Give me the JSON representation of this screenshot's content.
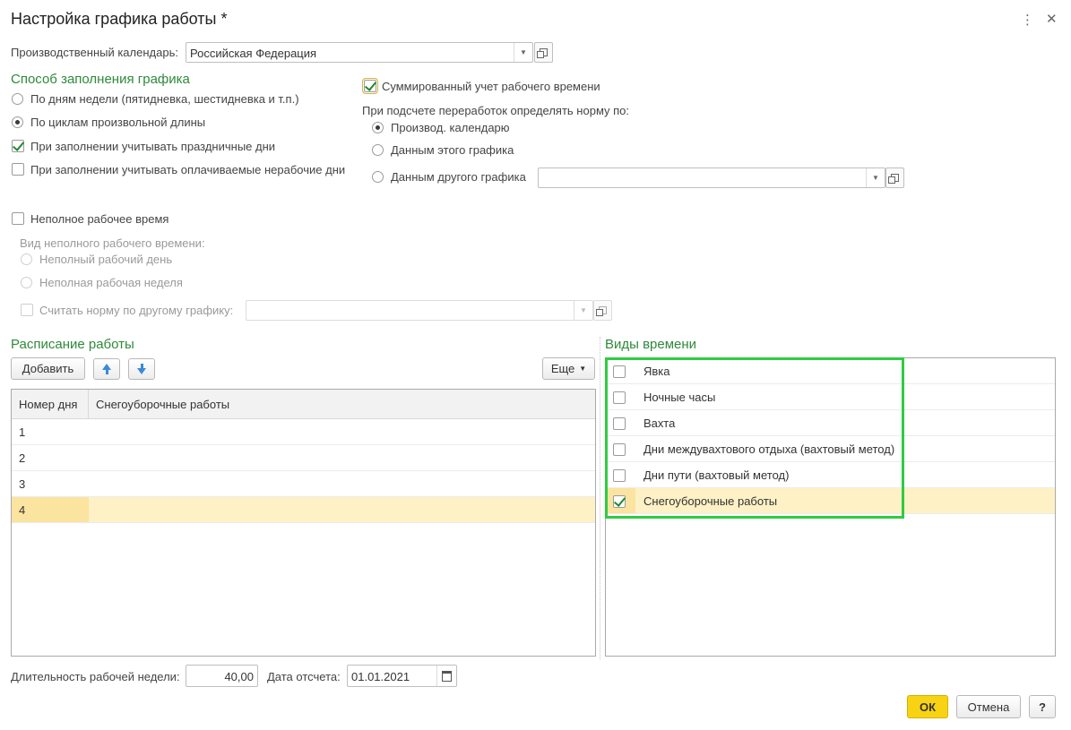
{
  "window": {
    "title": "Настройка графика работы *",
    "more_icon": "vertical-dots-icon",
    "close_icon": "close-icon"
  },
  "calendar": {
    "label": "Производственный календарь:",
    "value": "Российская Федерация"
  },
  "fill_method": {
    "heading": "Способ заполнения графика",
    "options": [
      {
        "label": "По дням недели (пятидневка, шестидневка и т.п.)",
        "selected": false
      },
      {
        "label": "По циклам произвольной длины",
        "selected": true
      }
    ],
    "holidays_checkbox": {
      "label": "При заполнении учитывать праздничные дни",
      "checked": true
    },
    "paid_nonwork_checkbox": {
      "label": "При заполнении учитывать оплачиваемые нерабочие дни",
      "checked": false
    }
  },
  "summarized": {
    "checkbox": {
      "label": "Суммированный учет рабочего времени",
      "checked": true
    },
    "norm_label": "При подсчете переработок определять норму по:",
    "options": [
      {
        "label": "Производ. календарю",
        "selected": true
      },
      {
        "label": "Данным этого графика",
        "selected": false
      },
      {
        "label": "Данным другого графика",
        "selected": false
      }
    ],
    "other_schedule_value": ""
  },
  "part_time": {
    "checkbox": {
      "label": "Неполное рабочее время",
      "checked": false
    },
    "kind_label": "Вид неполного рабочего времени:",
    "options": [
      {
        "label": "Неполный рабочий день",
        "selected": false
      },
      {
        "label": "Неполная рабочая неделя",
        "selected": false
      }
    ],
    "norm_checkbox": {
      "label": "Считать норму по другому графику:",
      "checked": false
    },
    "other_schedule_value": ""
  },
  "schedule": {
    "heading": "Расписание работы",
    "add_button": "Добавить",
    "more_button": "Еще",
    "columns": [
      "Номер дня",
      "Снегоуборочные работы"
    ],
    "rows": [
      {
        "day": "1",
        "value": "",
        "selected": false
      },
      {
        "day": "2",
        "value": "",
        "selected": false
      },
      {
        "day": "3",
        "value": "",
        "selected": false
      },
      {
        "day": "4",
        "value": "",
        "selected": true
      }
    ]
  },
  "time_kinds": {
    "heading": "Виды времени",
    "highlight_color": "#2ecc40",
    "items": [
      {
        "label": "Явка",
        "checked": false
      },
      {
        "label": "Ночные часы",
        "checked": false
      },
      {
        "label": "Вахта",
        "checked": false
      },
      {
        "label": "Дни междувахтового отдыха (вахтовый метод)",
        "checked": false
      },
      {
        "label": "Дни пути (вахтовый метод)",
        "checked": false
      },
      {
        "label": "Снегоуборочные работы",
        "checked": true
      }
    ]
  },
  "footer": {
    "week_length_label": "Длительность рабочей недели:",
    "week_length_value": "40,00",
    "start_date_label": "Дата отсчета:",
    "start_date_value": "01.01.2021",
    "ok_button": "ОК",
    "cancel_button": "Отмена",
    "help_button": "?"
  },
  "colors": {
    "accent_green": "#2f8a3a",
    "ok_yellow": "#f7d313",
    "selected_row": "#fdf1c5"
  }
}
